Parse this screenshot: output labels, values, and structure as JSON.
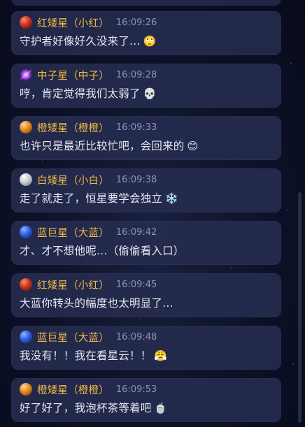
{
  "messages": [
    {
      "name": "红矮星（小红）",
      "time": "16:09:26",
      "text": "守护者好像好久没来了…",
      "emoji": "🙄",
      "orb": "red"
    },
    {
      "name": "中子星（中子）",
      "time": "16:09:28",
      "text": "哼，肯定觉得我们太弱了",
      "emoji": "💀",
      "orb": "neutron"
    },
    {
      "name": "橙矮星（橙橙）",
      "time": "16:09:33",
      "text": "也许只是最近比较忙吧，会回来的",
      "emoji": "😊",
      "orb": "orange"
    },
    {
      "name": "白矮星（小白）",
      "time": "16:09:38",
      "text": "走了就走了，恒星要学会独立",
      "emoji": "❄️",
      "orb": "white"
    },
    {
      "name": "蓝巨星（大蓝）",
      "time": "16:09:42",
      "text": "才、才不想他呢…（偷偷看入口）",
      "emoji": "",
      "orb": "blue"
    },
    {
      "name": "红矮星（小红）",
      "time": "16:09:45",
      "text": "大蓝你转头的幅度也太明显了…",
      "emoji": "",
      "orb": "red"
    },
    {
      "name": "蓝巨星（大蓝）",
      "time": "16:09:48",
      "text": "我没有！！我在看星云！！",
      "emoji": "😤",
      "orb": "blue"
    },
    {
      "name": "橙矮星（橙橙）",
      "time": "16:09:53",
      "text": "好了好了，我泡杯茶等着吧",
      "emoji": "🍵",
      "orb": "orange"
    }
  ]
}
